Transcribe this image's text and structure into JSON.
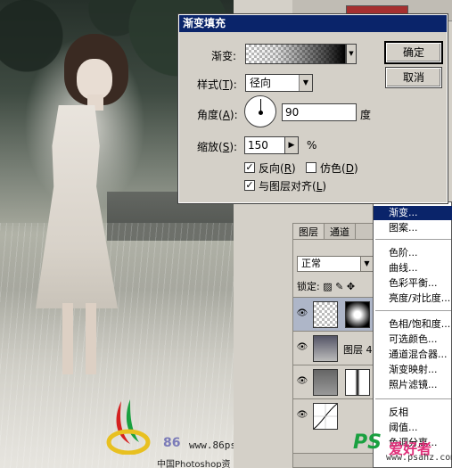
{
  "dialog": {
    "title": "渐变填充",
    "gradient_label": "渐变:",
    "style_label": "样式(",
    "style_key": "T",
    "style_value": "径向",
    "angle_label": "角度(",
    "angle_key": "A",
    "angle_value": "90",
    "angle_unit": "度",
    "scale_label": "缩放(",
    "scale_key": "S",
    "scale_value": "150",
    "scale_unit": "%",
    "reverse_label": "反向(",
    "reverse_key": "R",
    "reverse_checked": true,
    "dither_label": "仿色(",
    "dither_key": "D",
    "dither_checked": false,
    "align_label": "与图层对齐(",
    "align_key": "L",
    "align_checked": true,
    "ok_button": "确定",
    "cancel_button": "取消"
  },
  "layers": {
    "tabs": [
      "图层",
      "通道"
    ],
    "blend_mode": "正常",
    "lock_label": "锁定:",
    "rows": [
      {
        "name": ""
      },
      {
        "name": "图层 4"
      },
      {
        "name": ""
      },
      {
        "name": ""
      }
    ]
  },
  "context_menu": {
    "items": [
      "渐变...",
      "图案...",
      "色阶...",
      "曲线...",
      "色彩平衡...",
      "亮度/对比度...",
      "色相/饱和度...",
      "可选颜色...",
      "通道混合器...",
      "渐变映射...",
      "照片滤镜...",
      "反相",
      "阈值...",
      "色调分离..."
    ],
    "highlighted": "渐变..."
  },
  "logo": {
    "number": "86",
    "url": "www.86ps.com",
    "subtitle": "中国Photoshop资源网"
  },
  "watermark": {
    "ps": "PS",
    "text": "爱好者",
    "url": "www.psahz.com"
  },
  "colors": {
    "titlebar": "#0a246a",
    "menu_highlight": "#0a246a",
    "panel": "#d4d0c8"
  }
}
